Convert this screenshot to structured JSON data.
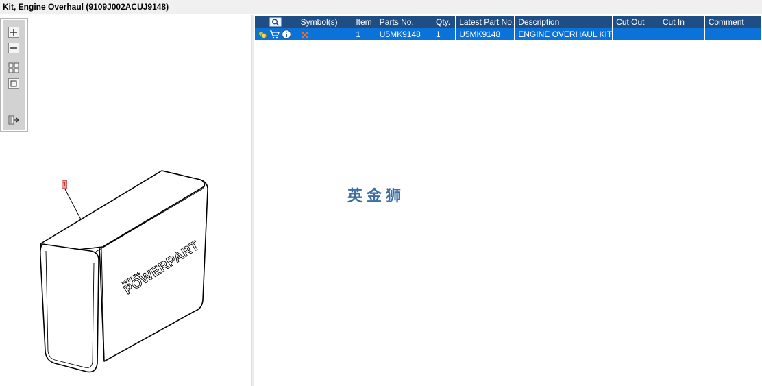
{
  "window": {
    "title": "Kit, Engine Overhaul (9109J002ACUJ9148)"
  },
  "toolbar": {
    "icons": [
      "zoom-in-icon",
      "zoom-out-icon",
      "fit-all-icon",
      "fit-window-icon",
      "export-icon"
    ]
  },
  "drawing": {
    "callout": "1",
    "box_label_brand": "POWERPART",
    "box_label_small": "PERKINS"
  },
  "table": {
    "columns": [
      "",
      "Symbol(s)",
      "Item",
      "Parts No.",
      "Qty.",
      "Latest Part No.",
      "Description",
      "Cut Out",
      "Cut In",
      "Comment"
    ],
    "rows": [
      {
        "item": "1",
        "parts_no": "U5MK9148",
        "qty": "1",
        "latest_part_no": "U5MK9148",
        "description": "ENGINE OVERHAUL KIT",
        "cut_out": "",
        "cut_in": "",
        "comment": ""
      }
    ]
  },
  "watermark": "英金狮",
  "colors": {
    "header_bg": "#1f4e85",
    "selected_row_bg": "#0a72d8",
    "callout_bg": "#f39a9a"
  }
}
